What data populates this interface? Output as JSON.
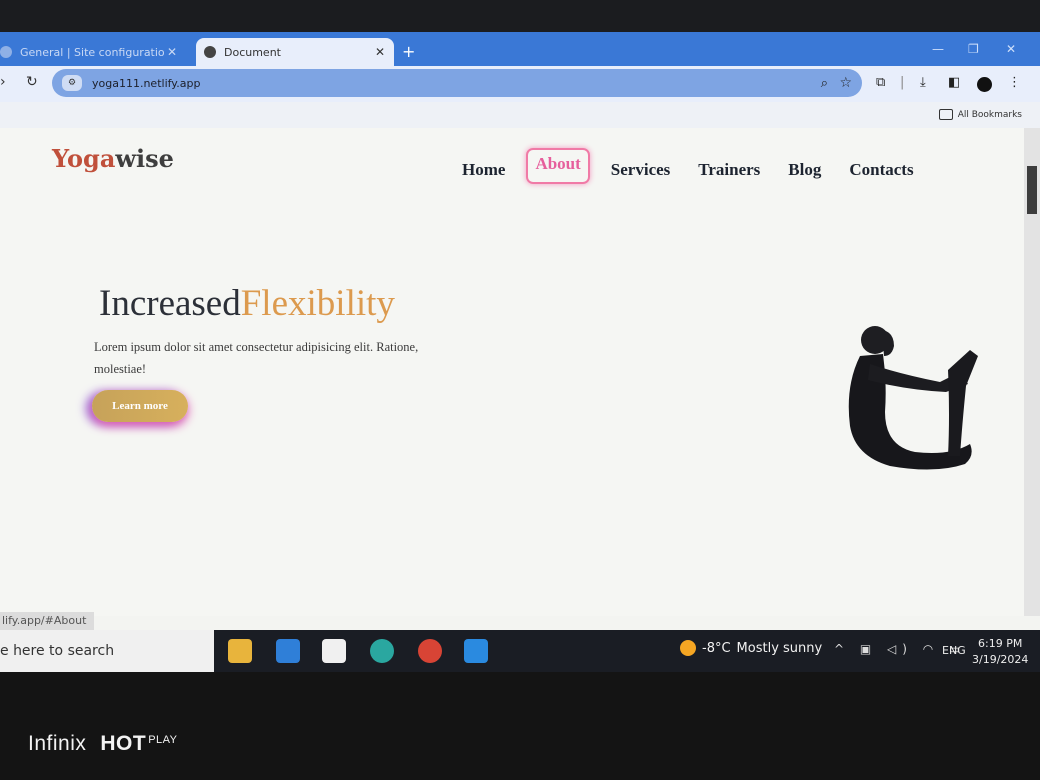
{
  "browser": {
    "tabs": [
      {
        "title": "General | Site configuration | yo",
        "active": false
      },
      {
        "title": "Document",
        "active": true
      }
    ],
    "new_tab": "+",
    "url": "yoga111.netlify.app",
    "bookmarks_label": "All Bookmarks"
  },
  "site": {
    "logo_part1": "Yoga",
    "logo_part2": "wise",
    "nav": [
      "Home",
      "About",
      "Services",
      "Trainers",
      "Blog",
      "Contacts"
    ],
    "active_nav": "About",
    "hero_title_1": "Increased",
    "hero_title_2": "Flexibility",
    "hero_text": "Lorem ipsum dolor sit amet consectetur adipisicing elit. Ratione, molestiae!",
    "cta": "Learn more",
    "status_url": "lify.app/#About"
  },
  "taskbar": {
    "search_placeholder": "e here to search",
    "weather_temp": "-8°C",
    "weather_desc": "Mostly sunny",
    "lang": "ENG",
    "time": "6:19 PM",
    "date": "3/19/2024"
  },
  "device": {
    "brand": "Infinix",
    "model": "HOT",
    "model_suffix": "PLAY"
  },
  "colors": {
    "logo_accent": "#c0503b",
    "hero_accent": "#dc9a4e",
    "nav_active": "#e65f9c",
    "tab_strip": "#3a78d6"
  }
}
